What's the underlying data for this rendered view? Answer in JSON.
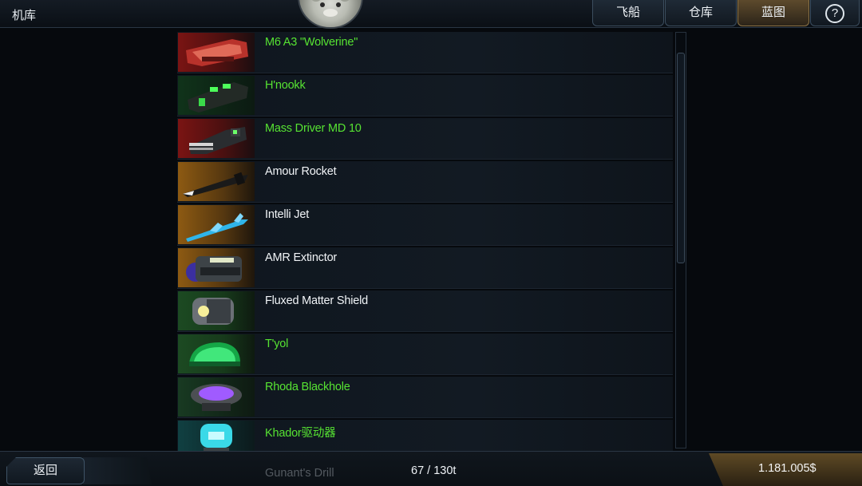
{
  "header": {
    "title": "机库",
    "tabs": [
      {
        "label": "飞船",
        "active": false
      },
      {
        "label": "仓库",
        "active": false
      },
      {
        "label": "蓝图",
        "active": true
      }
    ],
    "help_label": "?"
  },
  "items": [
    {
      "name": "M6 A3 \"Wolverine\"",
      "color": "#56e332",
      "icon": "red-cannon-icon"
    },
    {
      "name": "H'nookk",
      "color": "#56e332",
      "icon": "green-blaster-icon"
    },
    {
      "name": "Mass Driver MD 10",
      "color": "#56e332",
      "icon": "gatling-gun-icon"
    },
    {
      "name": "Amour Rocket",
      "color": "#f1f4f7",
      "icon": "rocket-icon"
    },
    {
      "name": "Intelli Jet",
      "color": "#f1f4f7",
      "icon": "jet-missile-icon"
    },
    {
      "name": "AMR Extinctor",
      "color": "#f1f4f7",
      "icon": "extinctor-cylinder-icon"
    },
    {
      "name": "Fluxed Matter Shield",
      "color": "#f1f4f7",
      "icon": "shield-generator-icon"
    },
    {
      "name": "T'yol",
      "color": "#56e332",
      "icon": "green-armor-icon"
    },
    {
      "name": "Rhoda Blackhole",
      "color": "#56e332",
      "icon": "purple-pod-icon"
    },
    {
      "name": "Khador驱动器",
      "color": "#56e332",
      "icon": "cyan-drive-icon"
    }
  ],
  "partial_item": "Gunant's Drill",
  "footer": {
    "back_label": "返回",
    "cargo": "67 / 130t",
    "credits": "1.181.005$"
  },
  "colors": {
    "accent_green": "#56e332",
    "accent_gold": "#8d7446",
    "background": "#06090d"
  }
}
